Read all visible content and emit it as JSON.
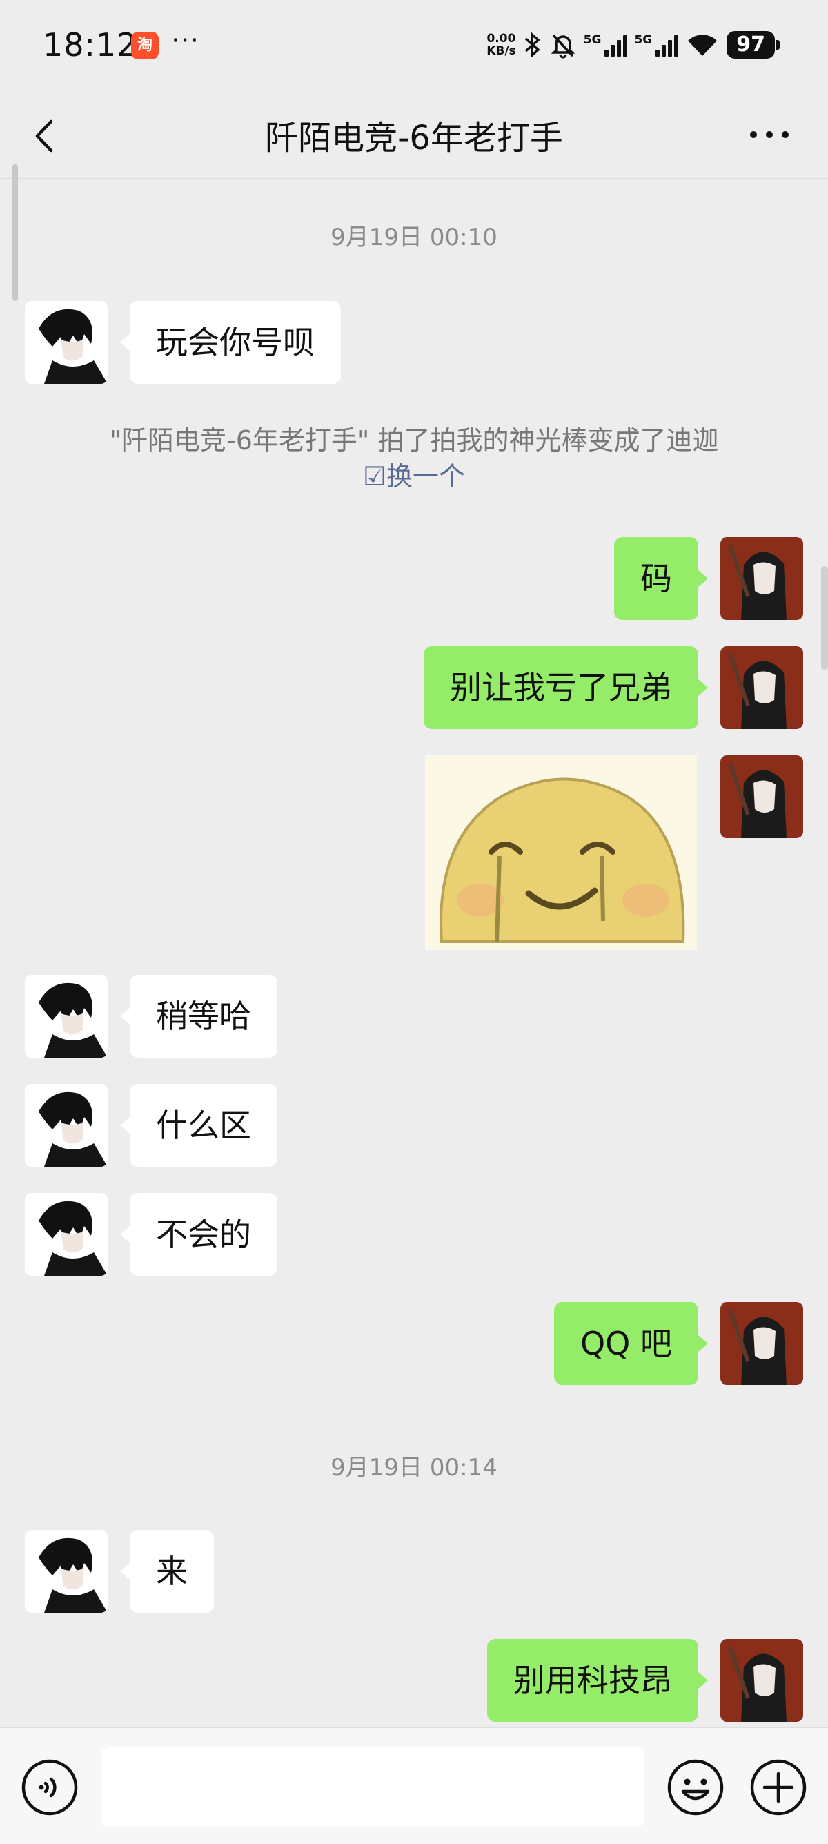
{
  "status_bar": {
    "time": "18:12",
    "app_badge": "淘",
    "overflow": "···",
    "net_speed_value": "0.00",
    "net_speed_unit": "KB/s",
    "network_1": "5G",
    "network_2": "5G",
    "battery": "97"
  },
  "header": {
    "title": "阡陌电竞-6年老打手"
  },
  "messages": {
    "ts1": "9月19日 00:10",
    "m1": "玩会你号呗",
    "system_text": "\"阡陌电竞-6年老打手\" 拍了拍我的神光棒变成了迪迦",
    "system_link": "换一个",
    "m2": "码",
    "m3": "别让我亏了兄弟",
    "m5": "稍等哈",
    "m6": "什么区",
    "m7": "不会的",
    "m8": "QQ 吧",
    "ts2": "9月19日 00:14",
    "m9": "来",
    "m10": "别用科技昂"
  },
  "input_bar": {
    "placeholder": ""
  },
  "colors": {
    "background": "#ededed",
    "outgoing_bubble": "#95ec69",
    "incoming_bubble": "#ffffff",
    "link": "#576b95"
  },
  "icons": [
    "back-icon",
    "more-icon",
    "voice-icon",
    "emoji-icon",
    "plus-icon",
    "bluetooth-icon",
    "mute-bell-icon",
    "wifi-icon"
  ]
}
